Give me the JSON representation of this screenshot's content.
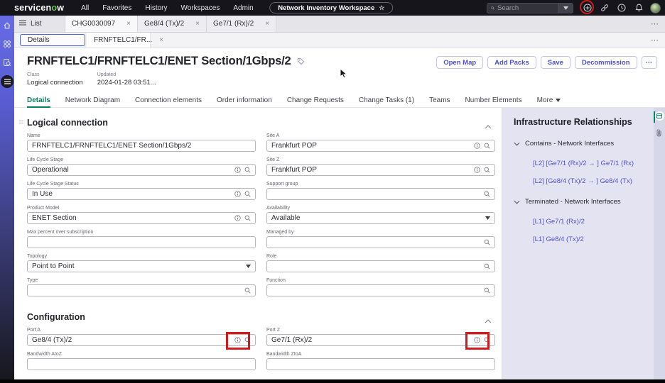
{
  "colors": {
    "accent": "#4d4fc8",
    "tab_active_green": "#0b7d62",
    "annotation_red": "#cf1b1b",
    "topnav_bg": "#15151b",
    "sidebar_top": "#666be4",
    "panel_bg": "#e3e3f1",
    "link": "#5151ce"
  },
  "topnav": {
    "logo_prefix": "servicen",
    "logo_o": "o",
    "logo_suffix": "w",
    "menu": [
      "All",
      "Favorites",
      "History",
      "Workspaces",
      "Admin"
    ],
    "workspace": "Network Inventory Workspace",
    "search_placeholder": "Search"
  },
  "ui": {
    "overflow_glyph": "⋯",
    "star_glyph": "☆",
    "close_glyph": "×"
  },
  "tabs_row1": [
    {
      "label": "List",
      "icon": "list",
      "closable": false
    },
    {
      "label": "CHG0030097",
      "closable": true
    },
    {
      "label": "Ge8/4 (Tx)/2",
      "closable": true
    },
    {
      "label": "Ge7/1 (Rx)/2",
      "closable": true
    }
  ],
  "tabs_row2": [
    {
      "label": "Details",
      "closable": false,
      "focused": true
    },
    {
      "label": "FRNFTELC1/FR...",
      "closable": true,
      "active": true
    }
  ],
  "header": {
    "title": "FRNFTELC1/FRNFTELC1/ENET Section/1Gbps/2",
    "meta": [
      {
        "label": "Class",
        "value": "Logical connection"
      },
      {
        "label": "Updated",
        "value": "2024-01-28 03:51..."
      }
    ],
    "actions": [
      "Open Map",
      "Add Packs",
      "Save",
      "Decommission"
    ],
    "more_button": "⋯"
  },
  "record_tabs": {
    "active_index": 0,
    "items": [
      "Details",
      "Network Diagram",
      "Connection elements",
      "Order information",
      "Change Requests",
      "Change Tasks (1)",
      "Teams",
      "Number Elements"
    ],
    "more_label": "More"
  },
  "form": {
    "sections": [
      {
        "title": "Logical connection",
        "columns": [
          [
            {
              "label": "Name",
              "value": "FRNFTELC1/FRNFTELC1/ENET Section/1Gbps/2",
              "icons": []
            },
            {
              "label": "Life Cycle Stage",
              "value": "Operational",
              "icons": [
                "info",
                "search"
              ]
            },
            {
              "label": "Life Cycle Stage Status",
              "value": "In Use",
              "icons": [
                "info",
                "search"
              ]
            },
            {
              "label": "Product Model",
              "value": "ENET Section",
              "icons": [
                "info",
                "search"
              ]
            },
            {
              "label": "Max percent over subscription",
              "value": "",
              "icons": []
            },
            {
              "label": "Topology",
              "value": "Point to Point",
              "icons": [
                "caret"
              ]
            },
            {
              "label": "Type",
              "value": "",
              "icons": [
                "search"
              ]
            }
          ],
          [
            {
              "label": "Site A",
              "value": "Frankfurt POP",
              "icons": [
                "info",
                "search"
              ]
            },
            {
              "label": "Site Z",
              "value": "Frankfurt POP",
              "icons": [
                "info",
                "search"
              ]
            },
            {
              "label": "Support group",
              "value": "",
              "icons": [
                "search"
              ]
            },
            {
              "label": "Availability",
              "value": "Available",
              "icons": [
                "caret"
              ]
            },
            {
              "label": "Managed by",
              "value": "",
              "icons": [
                "search"
              ]
            },
            {
              "label": "Role",
              "value": "",
              "icons": [
                "search"
              ]
            },
            {
              "label": "Function",
              "value": "",
              "icons": [
                "search"
              ]
            }
          ]
        ]
      },
      {
        "title": "Configuration",
        "columns": [
          [
            {
              "label": "Port A",
              "value": "Ge8/4 (Tx)/2",
              "icons": [
                "info",
                "search"
              ],
              "annotated": true
            },
            {
              "label": "Bandwidth AtoZ",
              "value": "",
              "icons": [],
              "clipped": true
            }
          ],
          [
            {
              "label": "Port Z",
              "value": "Ge7/1 (Rx)/2",
              "icons": [
                "info",
                "search"
              ],
              "annotated": true
            },
            {
              "label": "Bandwidth ZtoA",
              "value": "",
              "icons": [],
              "clipped": true
            }
          ]
        ]
      }
    ]
  },
  "relationships": {
    "title": "Infrastructure Relationships",
    "groups": [
      {
        "label": "Contains - Network Interfaces",
        "items": [
          "[L2] [Ge7/1 (Rx)/2 → ] Ge7/1 (Rx)",
          "[L2] [Ge8/4 (Tx)/2 → ] Ge8/4 (Tx)"
        ]
      },
      {
        "label": "Terminated - Network Interfaces",
        "items": [
          "[L1] Ge7/1 (Rx)/2",
          "[L1] Ge8/4 (Tx)/2"
        ]
      }
    ]
  }
}
